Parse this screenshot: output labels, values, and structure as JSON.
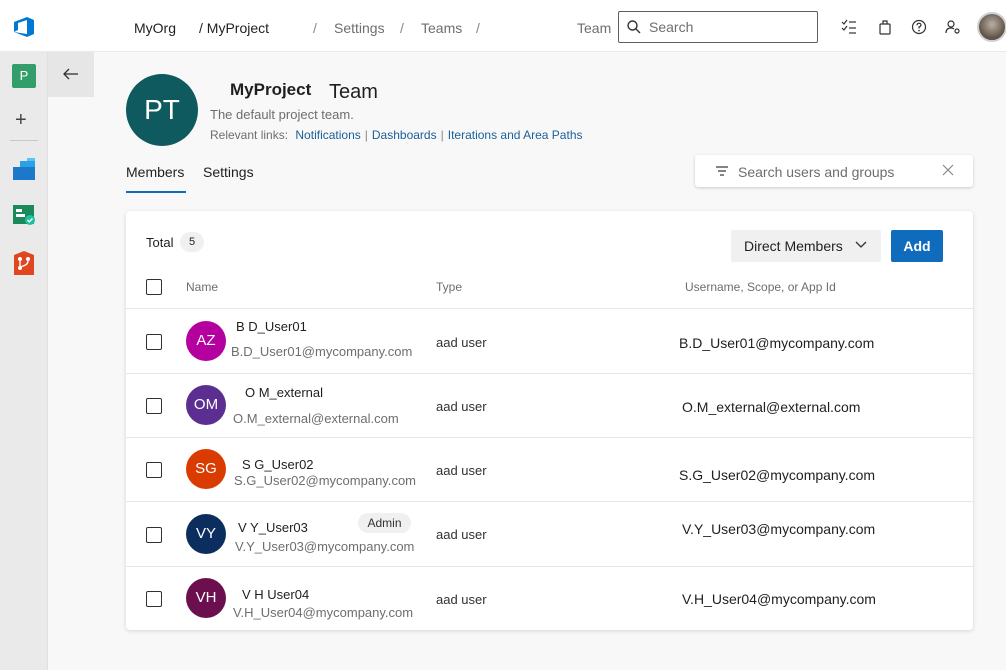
{
  "header": {
    "org": "MyOrg",
    "project": "/ MyProject",
    "settings": "Settings",
    "teams": "Teams",
    "team_label": "Team",
    "search_placeholder": "Search"
  },
  "leftnav": {
    "project_badge": "P"
  },
  "team": {
    "initials": "PT",
    "name": "MyProject",
    "suffix": "Team",
    "description": "The default project team.",
    "relevant_links_label": "Relevant links:",
    "links": [
      "Notifications",
      "Dashboards",
      "Iterations and Area Paths"
    ]
  },
  "tabs": [
    "Members",
    "Settings"
  ],
  "user_search_placeholder": "Search users and groups",
  "members": {
    "total_label": "Total",
    "total_count": "5",
    "filter_label": "Direct Members",
    "add_label": "Add",
    "columns": [
      "Name",
      "Type",
      "Username, Scope, or App Id"
    ],
    "rows": [
      {
        "initials": "AZ",
        "color": "#b4009e",
        "name": "B D_User01",
        "email": "B.D_User01@mycompany.com",
        "type": "aad user",
        "id": "B.D_User01@mycompany.com",
        "badge": ""
      },
      {
        "initials": "OM",
        "color": "#5c2e91",
        "name": "O M_external",
        "email": "O.M_external@external.com",
        "type": "aad user",
        "id": "O.M_external@external.com",
        "badge": ""
      },
      {
        "initials": "SG",
        "color": "#da3b01",
        "name": "S G_User02",
        "email": "S.G_User02@mycompany.com",
        "type": "aad user",
        "id": "S.G_User02@mycompany.com",
        "badge": ""
      },
      {
        "initials": "VY",
        "color": "#0b2e5f",
        "name": "V Y_User03",
        "email": "V.Y_User03@mycompany.com",
        "type": "aad user",
        "id": "V.Y_User03@mycompany.com",
        "badge": "Admin"
      },
      {
        "initials": "VH",
        "color": "#6b0f4f",
        "name": "V H  User04",
        "email": "V.H_User04@mycompany.com",
        "type": "aad user",
        "id": "V.H_User04@mycompany.com",
        "badge": ""
      }
    ]
  }
}
